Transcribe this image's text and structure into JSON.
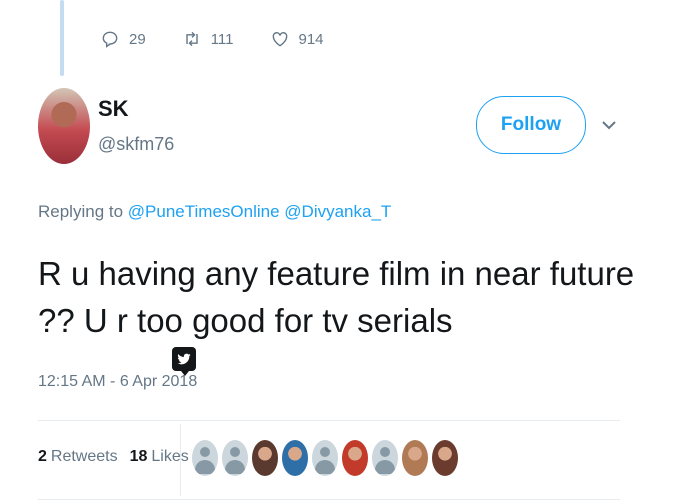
{
  "previous_tweet": {
    "reply_count": "29",
    "retweet_count": "111",
    "like_count": "914"
  },
  "tweet": {
    "author_name": "SK",
    "author_handle": "@skfm76",
    "follow_label": "Follow",
    "replying_prefix": "Replying to",
    "replying_to": [
      "@PuneTimesOnline",
      "@Divyanka_T"
    ],
    "text": "R u having any feature film in near future ?? U r too good for tv serials",
    "timestamp": "12:15 AM - 6 Apr 2018",
    "retweets_count": "2",
    "retweets_label": "Retweets",
    "likes_count": "18",
    "likes_label": "Likes"
  },
  "liker_avatars": [
    {
      "type": "default"
    },
    {
      "type": "default"
    },
    {
      "type": "photo",
      "color": "#5a3a2e"
    },
    {
      "type": "photo",
      "color": "#2f6fa8"
    },
    {
      "type": "default"
    },
    {
      "type": "photo",
      "color": "#c23a2a"
    },
    {
      "type": "default"
    },
    {
      "type": "photo",
      "color": "#b07a55"
    },
    {
      "type": "photo",
      "color": "#6b3b2e"
    }
  ],
  "colors": {
    "accent": "#1da1f2",
    "muted": "#657786",
    "text": "#14171a"
  }
}
